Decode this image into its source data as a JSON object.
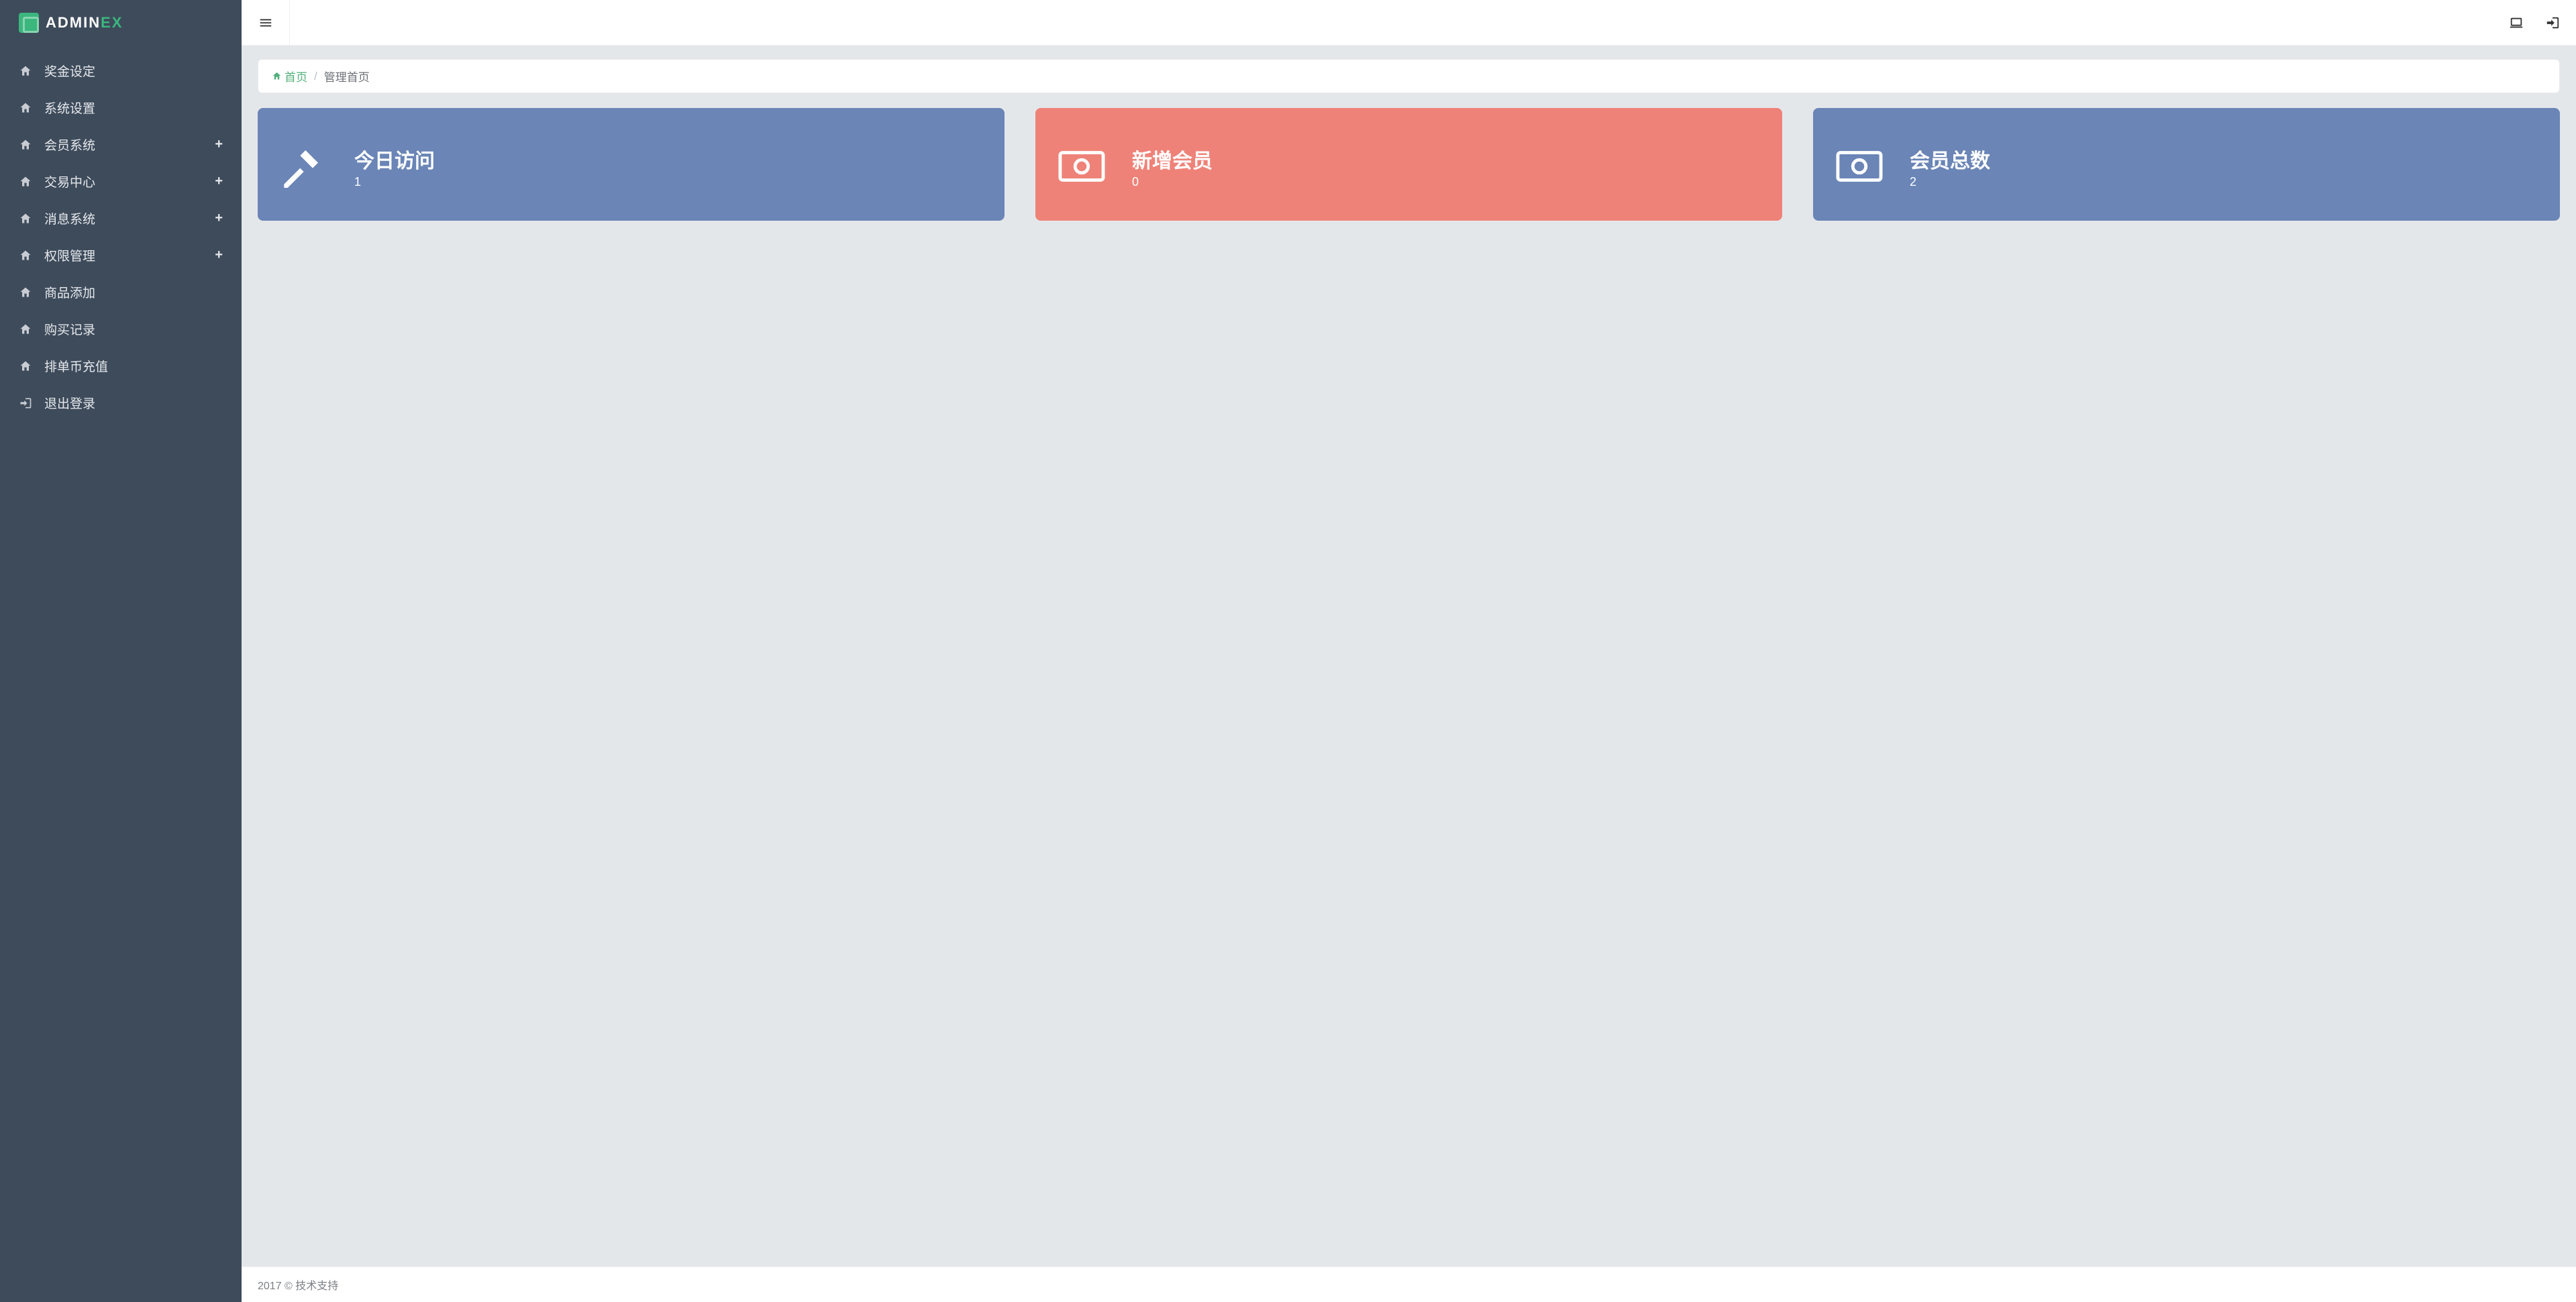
{
  "brand": {
    "part1": "ADMIN",
    "part2": "EX"
  },
  "sidebar": {
    "items": [
      {
        "label": "奖金设定",
        "expandable": false
      },
      {
        "label": "系统设置",
        "expandable": false
      },
      {
        "label": "会员系统",
        "expandable": true
      },
      {
        "label": "交易中心",
        "expandable": true
      },
      {
        "label": "消息系统",
        "expandable": true
      },
      {
        "label": "权限管理",
        "expandable": true
      },
      {
        "label": "商品添加",
        "expandable": false
      },
      {
        "label": "购买记录",
        "expandable": false
      },
      {
        "label": "排单币充值",
        "expandable": false
      },
      {
        "label": "退出登录",
        "expandable": false,
        "logout": true
      }
    ]
  },
  "breadcrumb": {
    "home": "首页",
    "current": "管理首页"
  },
  "cards": [
    {
      "title": "今日访问",
      "value": "1",
      "color": "blue",
      "icon": "gavel"
    },
    {
      "title": "新增会员",
      "value": "0",
      "color": "red",
      "icon": "money"
    },
    {
      "title": "会员总数",
      "value": "2",
      "color": "blue",
      "icon": "money"
    }
  ],
  "footer": "2017 © 技术支持",
  "expand_glyph": "+"
}
